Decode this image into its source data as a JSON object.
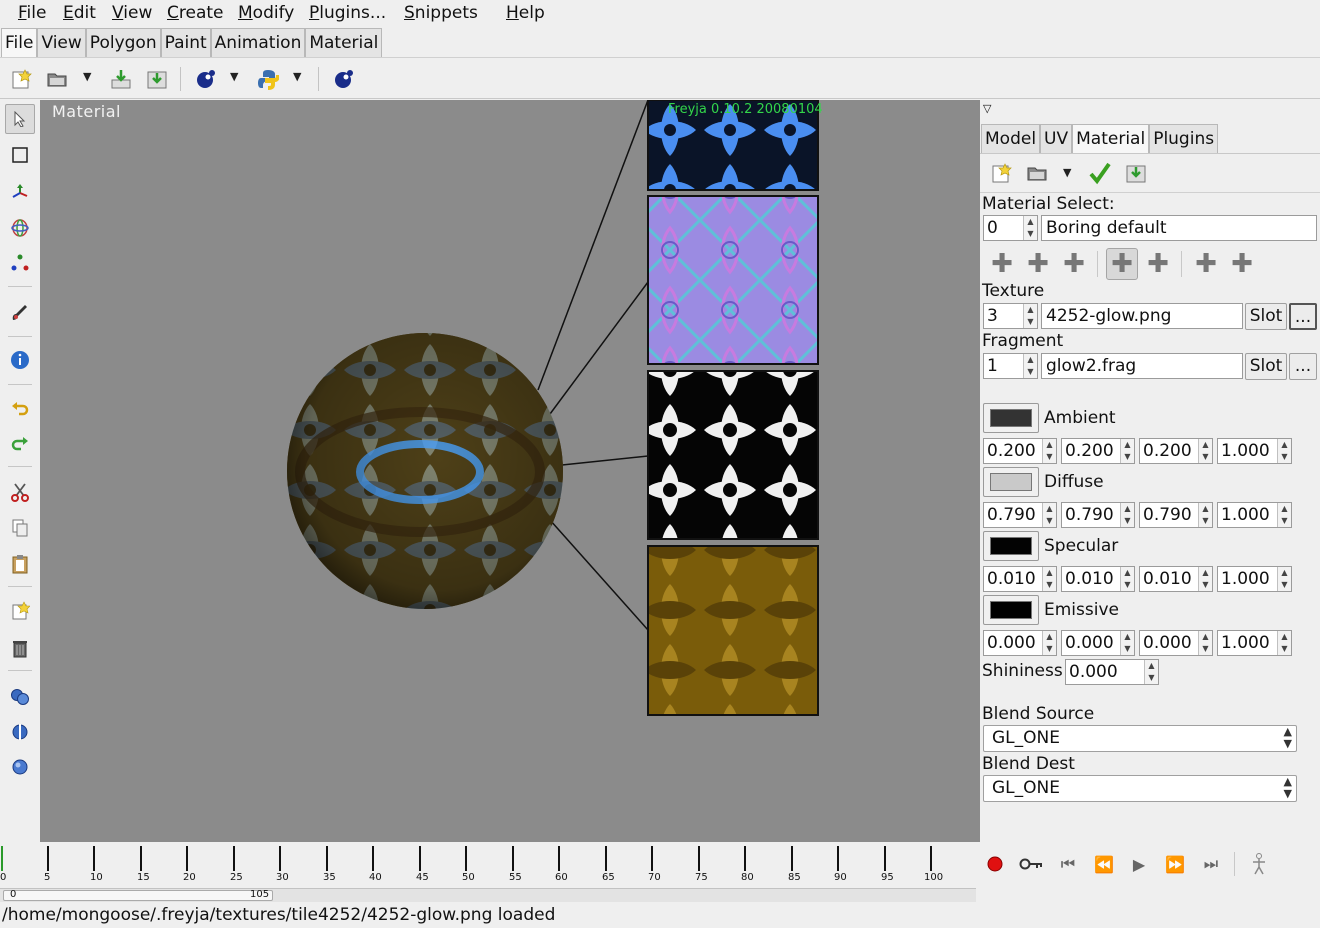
{
  "menu": [
    "File",
    "Edit",
    "View",
    "Create",
    "Modify",
    "Plugins...",
    "Snippets",
    "Help"
  ],
  "main_tabs": [
    "File",
    "View",
    "Polygon",
    "Paint",
    "Animation",
    "Material"
  ],
  "main_tabs_active": "File",
  "viewport": {
    "label": "Material",
    "version": "Freyja 0.10.2 20080104"
  },
  "right_tabs": [
    "Model",
    "UV",
    "Material",
    "Plugins"
  ],
  "right_tabs_active": "Material",
  "material": {
    "select_label": "Material Select:",
    "index": "0",
    "name": "Boring default",
    "texture_label": "Texture",
    "texture_index": "3",
    "texture_file": "4252-glow.png",
    "fragment_label": "Fragment",
    "fragment_index": "1",
    "fragment_file": "glow2.frag",
    "slot_label": "Slot",
    "browse_label": "...",
    "ambient": {
      "label": "Ambient",
      "swatch": "#333333",
      "values": [
        "0.200",
        "0.200",
        "0.200",
        "1.000"
      ]
    },
    "diffuse": {
      "label": "Diffuse",
      "swatch": "#c9c9c9",
      "values": [
        "0.790",
        "0.790",
        "0.790",
        "1.000"
      ]
    },
    "specular": {
      "label": "Specular",
      "swatch": "#030303",
      "values": [
        "0.010",
        "0.010",
        "0.010",
        "1.000"
      ]
    },
    "emissive": {
      "label": "Emissive",
      "swatch": "#000000",
      "values": [
        "0.000",
        "0.000",
        "0.000",
        "1.000"
      ]
    },
    "shininess_label": "Shininess",
    "shininess": "0.000",
    "blend_source_label": "Blend Source",
    "blend_source": "GL_ONE",
    "blend_dest_label": "Blend Dest",
    "blend_dest": "GL_ONE"
  },
  "timeline": {
    "ticks": [
      "0",
      "5",
      "10",
      "15",
      "20",
      "25",
      "30",
      "35",
      "40",
      "45",
      "50",
      "55",
      "60",
      "65",
      "70",
      "75",
      "80",
      "85",
      "90",
      "95",
      "100"
    ],
    "scroll_start": "0",
    "scroll_end": "105"
  },
  "status": "/home/mongoose/.freyja/textures/tile4252/4252-glow.png loaded",
  "colors": {
    "viewport_bg": "#8b8b8b",
    "version_text": "#33d64a",
    "glow_blue": "#4aa3ff",
    "bump_purple": "#9a8ae6",
    "gold": "#8a6a10"
  }
}
